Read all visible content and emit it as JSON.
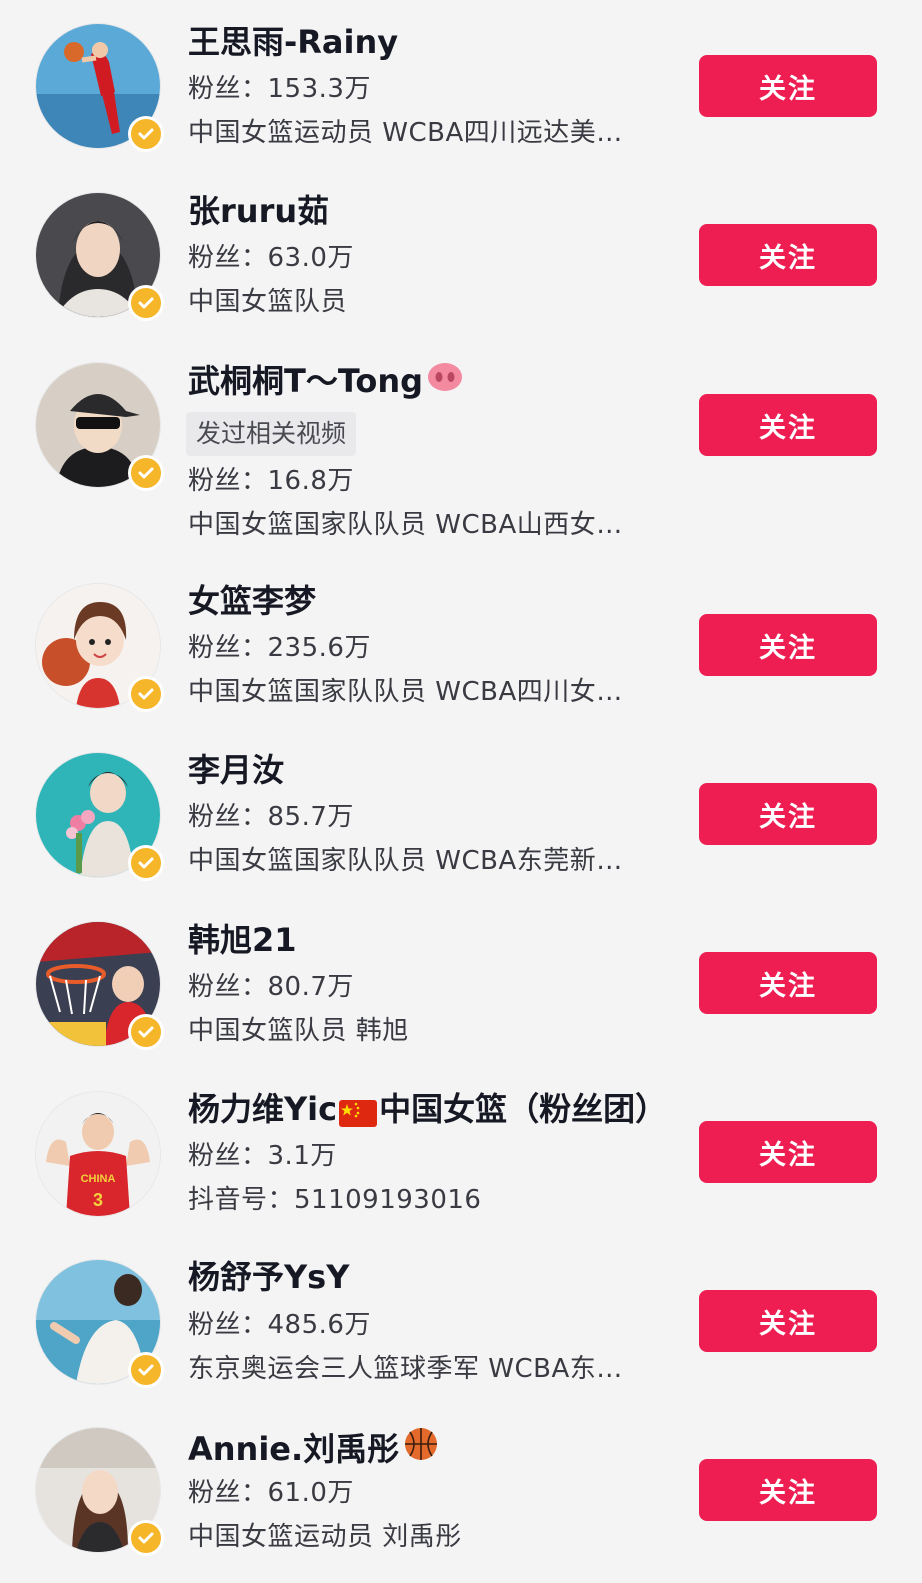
{
  "accent_color": "#ee1d52",
  "verified_color": "#f6b62a",
  "users": [
    {
      "name": "王思雨-Rainy",
      "fans_label": "粉丝：",
      "fans": "153.3万",
      "bio": "中国女篮运动员 WCBA四川远达美…",
      "follow": "关注",
      "avatar_icon": "basketball-player-jump-avatar"
    },
    {
      "name": "张ruru茹",
      "fans_label": "粉丝：",
      "fans": "63.0万",
      "bio": "中国女篮队员",
      "follow": "关注",
      "avatar_icon": "woman-portrait-avatar"
    },
    {
      "name": "武桐桐T～Tong",
      "name_emoji": "pig-nose-emoji",
      "tag": "发过相关视频",
      "fans_label": "粉丝：",
      "fans": "16.8万",
      "bio": "中国女篮国家队队员 WCBA山西女…",
      "follow": "关注",
      "avatar_icon": "cap-sunglasses-avatar"
    },
    {
      "name": "女篮李梦",
      "fans_label": "粉丝：",
      "fans": "235.6万",
      "bio": "中国女篮国家队队员 WCBA四川女…",
      "follow": "关注",
      "avatar_icon": "cartoon-girl-avatar"
    },
    {
      "name": "李月汝",
      "fans_label": "粉丝：",
      "fans": "85.7万",
      "bio": "中国女篮国家队队员 WCBA东莞新…",
      "follow": "关注",
      "avatar_icon": "flowers-trophy-avatar"
    },
    {
      "name": "韩旭21",
      "fans_label": "粉丝：",
      "fans": "80.7万",
      "bio": "中国女篮队员 韩旭",
      "follow": "关注",
      "avatar_icon": "basketball-hoop-avatar"
    },
    {
      "name_part1": "杨力维Yic",
      "name_part2": "中国女篮（粉丝团）",
      "name_flag": "china-flag-emoji",
      "fans_label": "粉丝：",
      "fans": "3.1万",
      "bio": "抖音号：51109193016",
      "follow": "关注",
      "avatar_icon": "china-jersey-player-avatar",
      "jersey_text": "CHINA",
      "jersey_number": "3"
    },
    {
      "name": "杨舒予YsY",
      "fans_label": "粉丝：",
      "fans": "485.6万",
      "bio": "东京奥运会三人篮球季军 WCBA东…",
      "follow": "关注",
      "avatar_icon": "beach-woman-avatar"
    },
    {
      "name": "Annie.刘禹彤",
      "name_emoji": "basketball-emoji",
      "fans_label": "粉丝：",
      "fans": "61.0万",
      "bio": "中国女篮运动员 刘禹彤",
      "follow": "关注",
      "avatar_icon": "car-selfie-avatar"
    }
  ]
}
